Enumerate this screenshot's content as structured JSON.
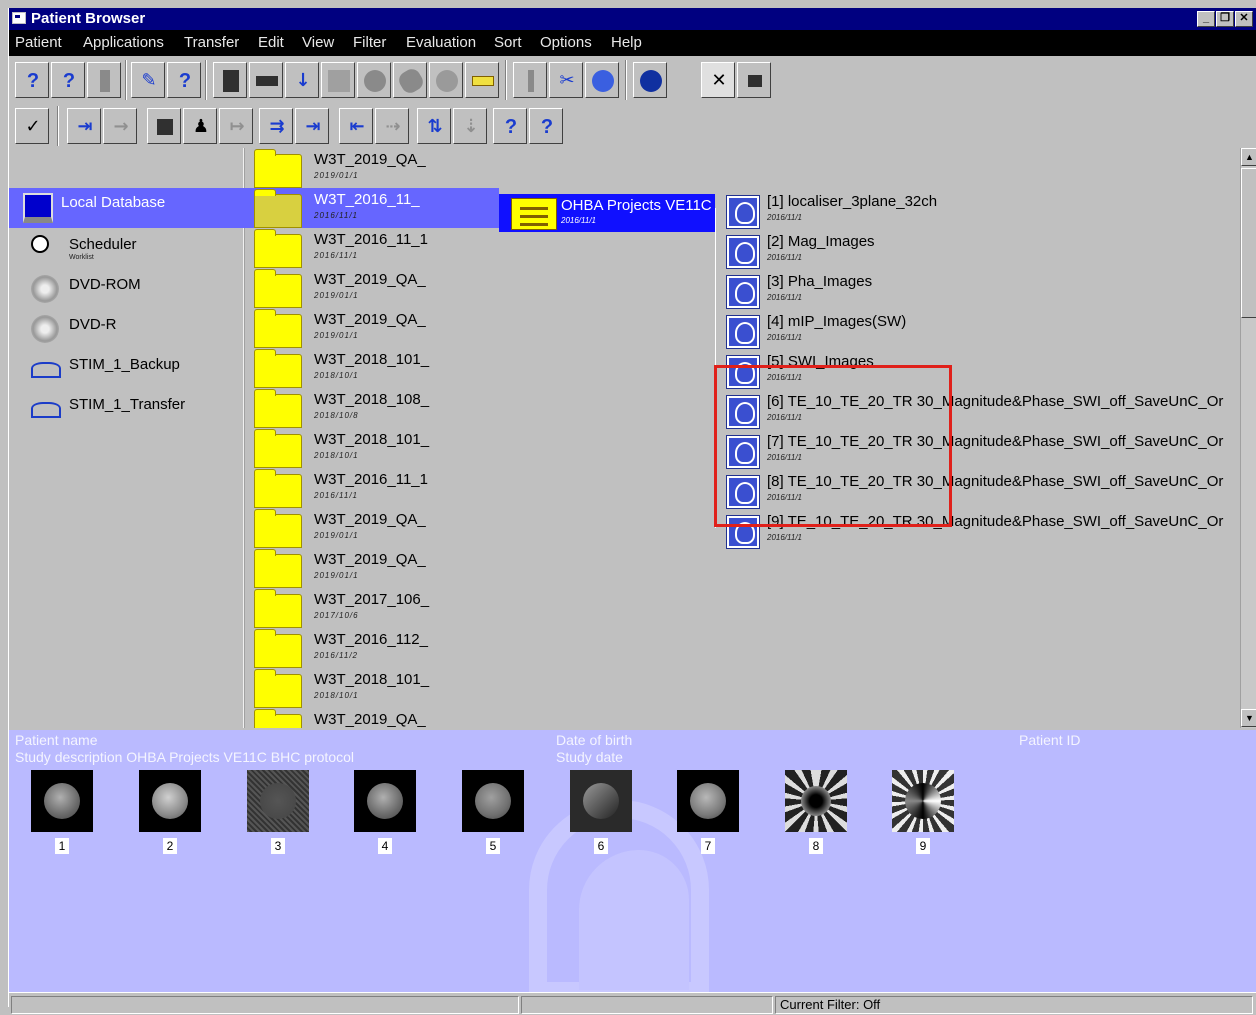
{
  "window": {
    "title": "Patient Browser",
    "controls": [
      "_",
      "❐",
      "✕"
    ]
  },
  "menu": [
    "Patient",
    "Applications",
    "Transfer",
    "Edit",
    "View",
    "Filter",
    "Evaluation",
    "Sort",
    "Options",
    "Help"
  ],
  "toolbar1": [
    "help-query-icon",
    "help-query-arrow-icon",
    "column-icon",
    "edit-pencil-icon",
    "query-blue-icon",
    "printer-icon",
    "film-roll-icon",
    "transfer-icon",
    "tools-icon",
    "record-icon",
    "eraser-icon",
    "gauge-icon",
    "tree-icon",
    "columns-icon",
    "cut-scissors-icon",
    "archive-icon",
    "globe-icon",
    "close-x-icon",
    "film-icon"
  ],
  "toolbar2": [
    "check-icon",
    "move-right-icon",
    "disabled-arrow-icon",
    "grid-icon",
    "person-icon",
    "disabled-move-icon",
    "expand-icon",
    "import-icon",
    "export-icon",
    "send-icon",
    "sort-icon",
    "disabled-sort-icon",
    "help-config-icon",
    "help-list-icon"
  ],
  "sources": [
    {
      "name": "local-database",
      "label": "Local Database",
      "sub": "",
      "icon": "computer-icon",
      "selected": true
    },
    {
      "name": "scheduler",
      "label": "Scheduler",
      "sub": "Worklist",
      "icon": "clock-icon",
      "selected": false
    },
    {
      "name": "dvd-rom",
      "label": "DVD-ROM",
      "sub": "",
      "icon": "disc-icon",
      "selected": false
    },
    {
      "name": "dvd-r",
      "label": "DVD-R",
      "sub": "",
      "icon": "disc-icon",
      "selected": false
    },
    {
      "name": "stim-backup",
      "label": "STIM_1_Backup",
      "sub": "",
      "icon": "network-icon",
      "selected": false
    },
    {
      "name": "stim-transfer",
      "label": "STIM_1_Transfer",
      "sub": "",
      "icon": "network-icon",
      "selected": false
    }
  ],
  "patients": [
    {
      "label": "W3T_2019_QA_",
      "sub": "2019/01/1",
      "selected": false
    },
    {
      "label": "W3T_2016_11_",
      "sub": "2016/11/1",
      "selected": true
    },
    {
      "label": "W3T_2016_11_1",
      "sub": "2016/11/1",
      "selected": false
    },
    {
      "label": "W3T_2019_QA_",
      "sub": "2019/01/1",
      "selected": false
    },
    {
      "label": "W3T_2019_QA_",
      "sub": "2019/01/1",
      "selected": false
    },
    {
      "label": "W3T_2018_101_",
      "sub": "2018/10/1",
      "selected": false
    },
    {
      "label": "W3T_2018_108_",
      "sub": "2018/10/8",
      "selected": false
    },
    {
      "label": "W3T_2018_101_",
      "sub": "2018/10/1",
      "selected": false
    },
    {
      "label": "W3T_2016_11_1",
      "sub": "2016/11/1",
      "selected": false
    },
    {
      "label": "W3T_2019_QA_",
      "sub": "2019/01/1",
      "selected": false
    },
    {
      "label": "W3T_2019_QA_",
      "sub": "2019/01/1",
      "selected": false
    },
    {
      "label": "W3T_2017_106_",
      "sub": "2017/10/6",
      "selected": false
    },
    {
      "label": "W3T_2016_112_",
      "sub": "2016/11/2",
      "selected": false
    },
    {
      "label": "W3T_2018_101_",
      "sub": "2018/10/1",
      "selected": false
    },
    {
      "label": "W3T_2019_QA_",
      "sub": "",
      "selected": false
    }
  ],
  "study": {
    "label": "OHBA Projects VE11C",
    "sub": "2016/11/1"
  },
  "series": [
    {
      "label": "[1] localiser_3plane_32ch",
      "sub": "2016/11/1"
    },
    {
      "label": "[2] Mag_Images",
      "sub": "2016/11/1"
    },
    {
      "label": "[3] Pha_Images",
      "sub": "2016/11/1"
    },
    {
      "label": "[4] mIP_Images(SW)",
      "sub": "2016/11/1"
    },
    {
      "label": "[5] SWI_Images",
      "sub": "2016/11/1"
    },
    {
      "label": "[6] TE_10_TE_20_TR 30_Magnitude&Phase_SWI_off_SaveUnC_Or",
      "sub": "2016/11/1"
    },
    {
      "label": "[7] TE_10_TE_20_TR 30_Magnitude&Phase_SWI_off_SaveUnC_Or",
      "sub": "2016/11/1"
    },
    {
      "label": "[8] TE_10_TE_20_TR 30_Magnitude&Phase_SWI_off_SaveUnC_Or",
      "sub": "2016/11/1"
    },
    {
      "label": "[9] TE_10_TE_20_TR 30_Magnitude&Phase_SWI_off_SaveUnC_Or",
      "sub": "2016/11/1"
    }
  ],
  "preview": {
    "patient_name_label": "Patient name",
    "study_description_label": "Study description OHBA Projects VE11C BHC protocol",
    "dob_label": "Date of birth",
    "study_date_label": "Study date",
    "patient_id_label": "Patient ID",
    "thumbnails": [
      "1",
      "2",
      "3",
      "4",
      "5",
      "6",
      "7",
      "8",
      "9"
    ]
  },
  "status": {
    "current_filter": "Current Filter: Off"
  },
  "colors": {
    "selection": "#6666ff",
    "study_selection": "#1010ff",
    "preview_bg": "#babaff",
    "highlight_box": "#e0201a",
    "titlebar": "#000080"
  }
}
